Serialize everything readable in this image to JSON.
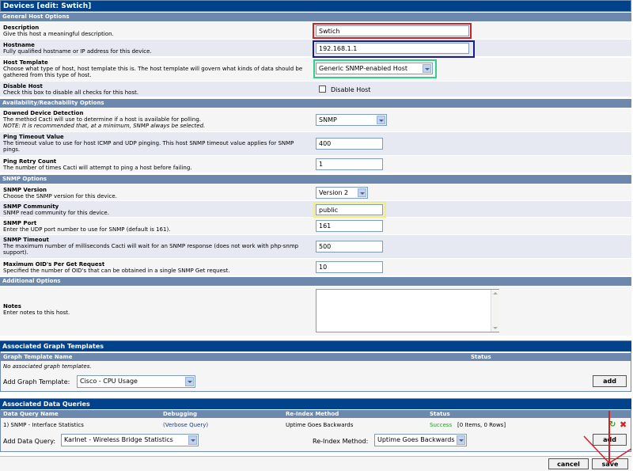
{
  "header": {
    "title": "Devices [edit: Swtich]"
  },
  "sections": {
    "general": "General Host Options",
    "availability": "Availability/Reachability Options",
    "snmp": "SNMP Options",
    "additional": "Additional Options"
  },
  "fields": {
    "description": {
      "label": "Description",
      "help": "Give this host a meaningful description.",
      "value": "Swtich"
    },
    "hostname": {
      "label": "Hostname",
      "help": "Fully qualified hostname or IP address for this device.",
      "value": "192.168.1.1"
    },
    "host_template": {
      "label": "Host Template",
      "help": "Choose what type of host, host template this is. The host template will govern what kinds of data should be gathered from this type of host.",
      "value": "Generic SNMP-enabled Host"
    },
    "disable_host": {
      "label": "Disable Host",
      "help": "Check this box to disable all checks for this host.",
      "checkbox_label": "Disable Host",
      "checked": false
    },
    "downed_detection": {
      "label": "Downed Device Detection",
      "help": "The method Cacti will use to determine if a host is available for polling.",
      "note": "NOTE: It is recommended that, at a minimum, SNMP always be selected.",
      "value": "SNMP"
    },
    "ping_timeout": {
      "label": "Ping Timeout Value",
      "help": "The timeout value to use for host ICMP and UDP pinging. This host SNMP timeout value applies for SNMP pings.",
      "value": "400"
    },
    "ping_retry": {
      "label": "Ping Retry Count",
      "help": "The number of times Cacti will attempt to ping a host before failing.",
      "value": "1"
    },
    "snmp_version": {
      "label": "SNMP Version",
      "help": "Choose the SNMP version for this device.",
      "value": "Version 2"
    },
    "snmp_community": {
      "label": "SNMP Community",
      "help": "SNMP read community for this device.",
      "value": "public"
    },
    "snmp_port": {
      "label": "SNMP Port",
      "help": "Enter the UDP port number to use for SNMP (default is 161).",
      "value": "161"
    },
    "snmp_timeout": {
      "label": "SNMP Timeout",
      "help": "The maximum number of milliseconds Cacti will wait for an SNMP response (does not work with php-snmp support).",
      "value": "500"
    },
    "max_oids": {
      "label": "Maximum OID's Per Get Request",
      "help": "Specified the number of OID's that can be obtained in a single SNMP Get request.",
      "value": "10"
    },
    "notes": {
      "label": "Notes",
      "help": "Enter notes to this host.",
      "value": ""
    }
  },
  "graph_templates": {
    "title": "Associated Graph Templates",
    "columns": [
      "Graph Template Name",
      "Status"
    ],
    "empty_text": "No associated graph templates.",
    "add_label": "Add Graph Template:",
    "add_value": "Cisco - CPU Usage",
    "add_button": "add"
  },
  "data_queries": {
    "title": "Associated Data Queries",
    "columns": [
      "Data Query Name",
      "Debugging",
      "Re-Index Method",
      "Status"
    ],
    "rows": [
      {
        "name": "1) SNMP - Interface Statistics",
        "debug": "(Verbose Query)",
        "reindex": "Uptime Goes Backwards",
        "status_ok": "Success",
        "status_rest": "[0 Items, 0 Rows]"
      }
    ],
    "add_label": "Add Data Query:",
    "add_value": "Karlnet - Wireless Bridge Statistics",
    "reindex_label": "Re-Index Method:",
    "reindex_value": "Uptime Goes Backwards",
    "add_button": "add"
  },
  "footer": {
    "cancel": "cancel",
    "save": "save"
  },
  "colors": {
    "header_bg": "#00438c",
    "section_bg": "#6d88ad",
    "highlight_red": "#d42020",
    "highlight_navy": "#1a1a8c",
    "highlight_green": "#33cc88",
    "highlight_yellow": "#f2ee7a"
  }
}
